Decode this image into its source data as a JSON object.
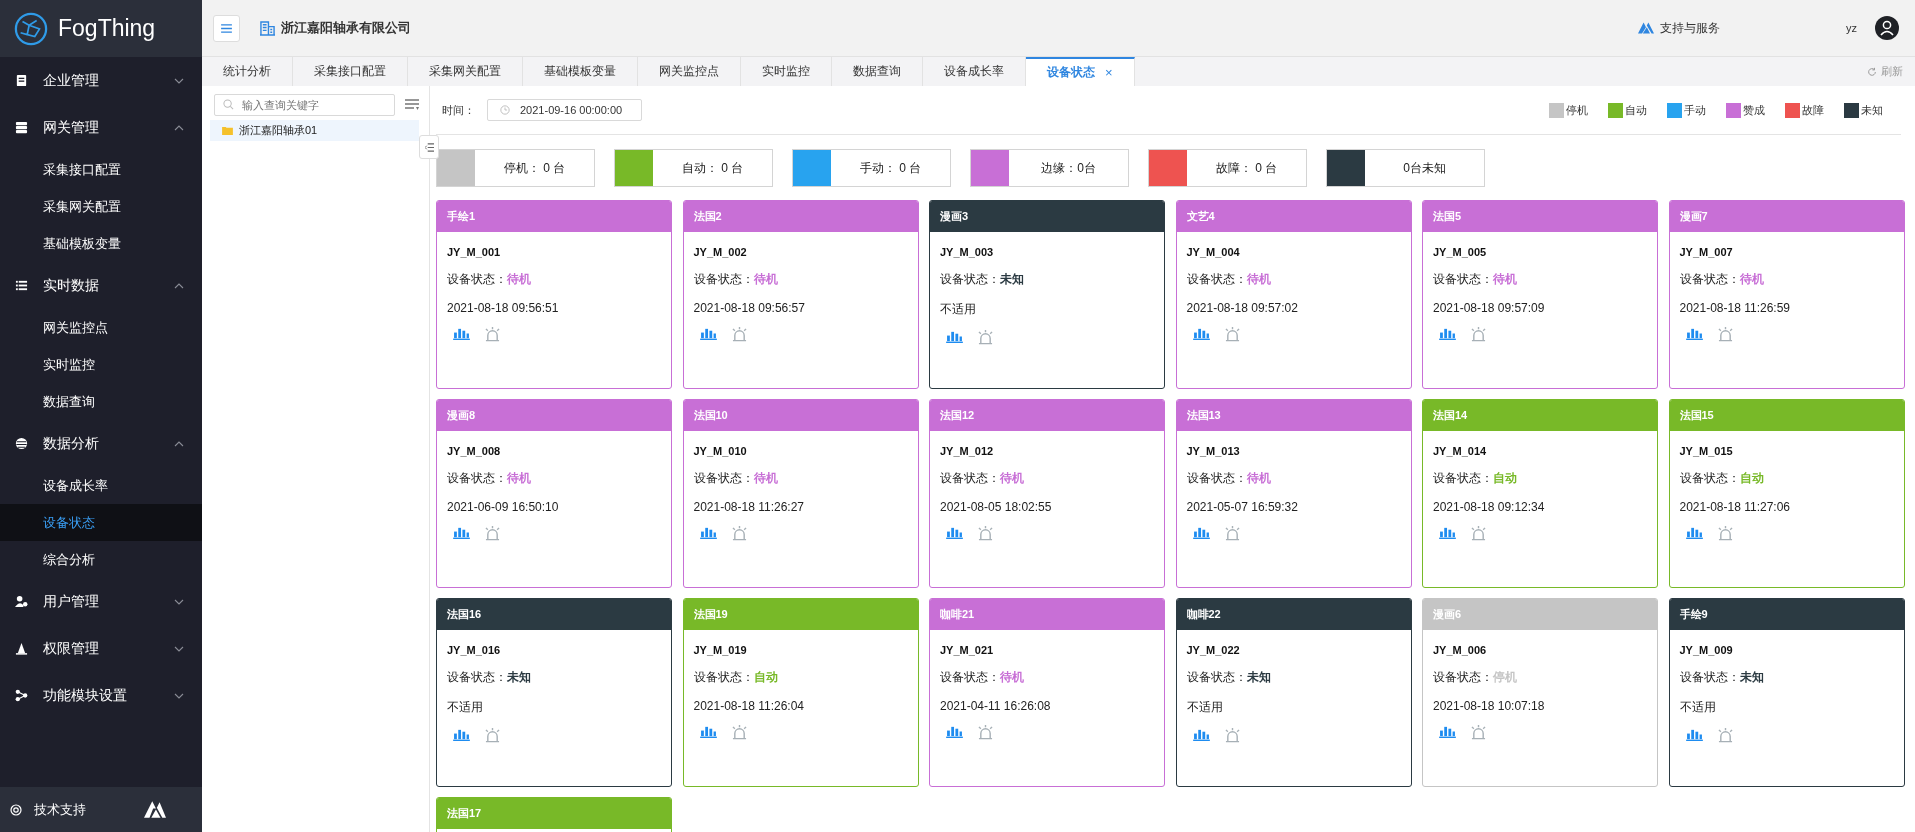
{
  "sidebar": {
    "logo": "FogThing",
    "menu": [
      {
        "label": "企业管理",
        "expanded": false
      },
      {
        "label": "网关管理",
        "expanded": true,
        "children": [
          {
            "label": "采集接口配置",
            "selected": false
          },
          {
            "label": "采集网关配置",
            "selected": false
          },
          {
            "label": "基础模板变量",
            "selected": false
          }
        ]
      },
      {
        "label": "实时数据",
        "expanded": true,
        "children": [
          {
            "label": "网关监控点",
            "selected": false
          },
          {
            "label": "实时监控",
            "selected": false
          },
          {
            "label": "数据查询",
            "selected": false
          }
        ]
      },
      {
        "label": "数据分析",
        "expanded": true,
        "children": [
          {
            "label": "设备成长率",
            "selected": false
          },
          {
            "label": "设备状态",
            "selected": true
          },
          {
            "label": "综合分析",
            "selected": false
          }
        ]
      },
      {
        "label": "用户管理",
        "expanded": false
      },
      {
        "label": "权限管理",
        "expanded": false
      },
      {
        "label": "功能模块设置",
        "expanded": false
      }
    ],
    "footer": "技术支持"
  },
  "header": {
    "company": "浙江嘉阳轴承有限公司",
    "support": "支持与服务",
    "user": "yz"
  },
  "tabs": [
    {
      "label": "统计分析",
      "selected": false
    },
    {
      "label": "采集接口配置",
      "selected": false
    },
    {
      "label": "采集网关配置",
      "selected": false
    },
    {
      "label": "基础模板变量",
      "selected": false
    },
    {
      "label": "网关监控点",
      "selected": false
    },
    {
      "label": "实时监控",
      "selected": false
    },
    {
      "label": "数据查询",
      "selected": false
    },
    {
      "label": "设备成长率",
      "selected": false
    },
    {
      "label": "设备状态",
      "selected": true,
      "close": "×"
    }
  ],
  "refresh": "刷新",
  "tree": {
    "placeholder": "输入查询关键字",
    "nodes": [
      {
        "label": "浙江嘉阳轴承01",
        "selected": true
      }
    ]
  },
  "filter": {
    "label": "时间：",
    "value": "2021-09-16 00:00:00"
  },
  "legend": [
    {
      "label": "停机",
      "color": "#c5c5c5"
    },
    {
      "label": "自动",
      "color": "#78b928"
    },
    {
      "label": "手动",
      "color": "#28a3ef"
    },
    {
      "label": "赞成",
      "color": "#c86fd6"
    },
    {
      "label": "故障",
      "color": "#ee5350"
    },
    {
      "label": "未知",
      "color": "#2b3a42"
    }
  ],
  "summary": [
    {
      "text": "停机： 0 台",
      "color": "#c5c5c5"
    },
    {
      "text": "自动： 0 台",
      "color": "#78b928"
    },
    {
      "text": "手动： 0 台",
      "color": "#28a3ef"
    },
    {
      "text": "边缘：0台",
      "color": "#c86fd6"
    },
    {
      "text": "故障： 0 台",
      "color": "#ee5350"
    },
    {
      "text": "0台未知",
      "color": "#2b3a42"
    }
  ],
  "cards": [
    {
      "title": "手绘1",
      "color": "#c86fd6",
      "code": "JY_M_001",
      "status_label": "设备状态：",
      "status": "待机",
      "time": "2021-08-18 09:56:51"
    },
    {
      "title": "法国2",
      "color": "#c86fd6",
      "code": "JY_M_002",
      "status_label": "设备状态：",
      "status": "待机",
      "time": "2021-08-18 09:56:57"
    },
    {
      "title": "漫画3",
      "color": "#2b3a42",
      "code": "JY_M_003",
      "status_label": "设备状态：",
      "status": "未知",
      "time": "不适用"
    },
    {
      "title": "文艺4",
      "color": "#c86fd6",
      "code": "JY_M_004",
      "status_label": "设备状态：",
      "status": "待机",
      "time": "2021-08-18 09:57:02"
    },
    {
      "title": "法国5",
      "color": "#c86fd6",
      "code": "JY_M_005",
      "status_label": "设备状态：",
      "status": "待机",
      "time": "2021-08-18 09:57:09"
    },
    {
      "title": "漫画7",
      "color": "#c86fd6",
      "code": "JY_M_007",
      "status_label": "设备状态：",
      "status": "待机",
      "time": "2021-08-18 11:26:59"
    },
    {
      "title": "漫画8",
      "color": "#c86fd6",
      "code": "JY_M_008",
      "status_label": "设备状态：",
      "status": "待机",
      "time": "2021-06-09 16:50:10"
    },
    {
      "title": "法国10",
      "color": "#c86fd6",
      "code": "JY_M_010",
      "status_label": "设备状态：",
      "status": "待机",
      "time": "2021-08-18 11:26:27"
    },
    {
      "title": "法国12",
      "color": "#c86fd6",
      "code": "JY_M_012",
      "status_label": "设备状态：",
      "status": "待机",
      "time": "2021-08-05 18:02:55"
    },
    {
      "title": "法国13",
      "color": "#c86fd6",
      "code": "JY_M_013",
      "status_label": "设备状态：",
      "status": "待机",
      "time": "2021-05-07 16:59:32"
    },
    {
      "title": "法国14",
      "color": "#78b928",
      "code": "JY_M_014",
      "status_label": "设备状态：",
      "status": "自动",
      "time": "2021-08-18 09:12:34"
    },
    {
      "title": "法国15",
      "color": "#78b928",
      "code": "JY_M_015",
      "status_label": "设备状态：",
      "status": "自动",
      "time": "2021-08-18 11:27:06"
    },
    {
      "title": "法国16",
      "color": "#2b3a42",
      "code": "JY_M_016",
      "status_label": "设备状态：",
      "status": "未知",
      "time": "不适用"
    },
    {
      "title": "法国19",
      "color": "#78b928",
      "code": "JY_M_019",
      "status_label": "设备状态：",
      "status": "自动",
      "time": "2021-08-18 11:26:04"
    },
    {
      "title": "咖啡21",
      "color": "#c86fd6",
      "code": "JY_M_021",
      "status_label": "设备状态：",
      "status": "待机",
      "time": "2021-04-11 16:26:08"
    },
    {
      "title": "咖啡22",
      "color": "#2b3a42",
      "code": "JY_M_022",
      "status_label": "设备状态：",
      "status": "未知",
      "time": "不适用"
    },
    {
      "title": "漫画6",
      "color": "#c5c5c5",
      "code": "JY_M_006",
      "status_label": "设备状态：",
      "status": "停机",
      "time": "2021-08-18 10:07:18"
    },
    {
      "title": "手绘9",
      "color": "#2b3a42",
      "code": "JY_M_009",
      "status_label": "设备状态：",
      "status": "未知",
      "time": "不适用"
    },
    {
      "title": "法国17",
      "color": "#78b928"
    }
  ]
}
